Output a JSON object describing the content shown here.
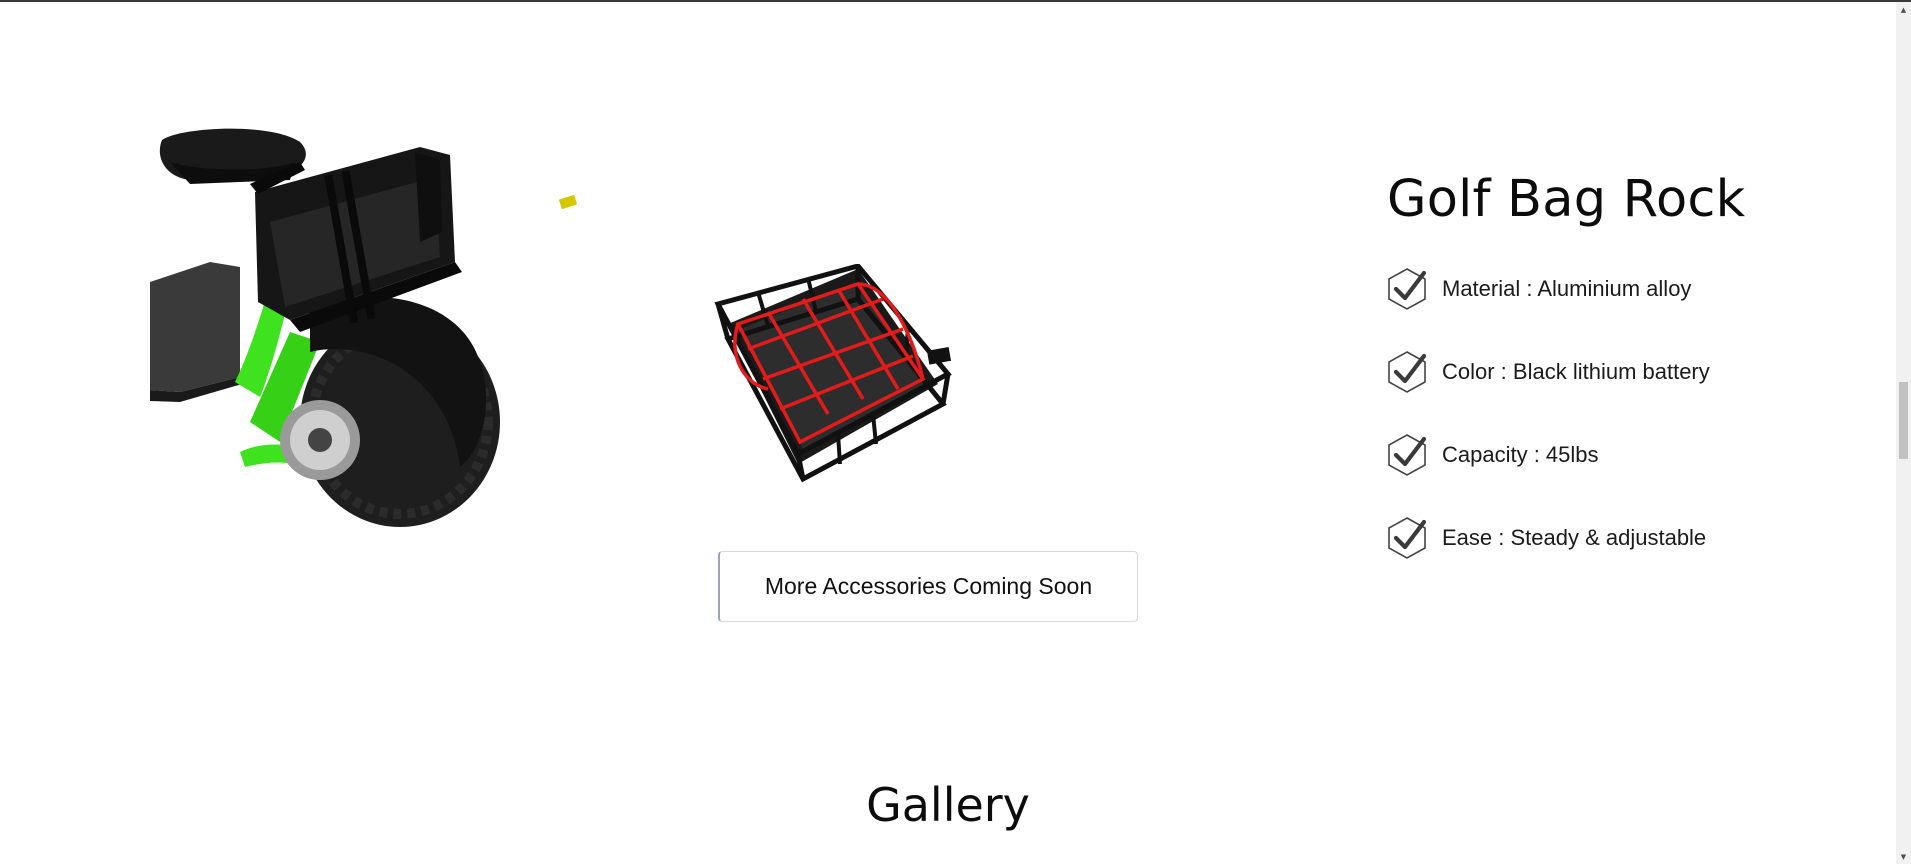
{
  "product": {
    "title": "Golf Bag Rock",
    "features": [
      {
        "text": "Material : Aluminium alloy",
        "icon": "checkmark-hexagon-icon"
      },
      {
        "text": "Color : Black lithium battery",
        "icon": "checkmark-hexagon-icon"
      },
      {
        "text": "Capacity : 45lbs",
        "icon": "checkmark-hexagon-icon"
      },
      {
        "text": "Ease : Steady & adjustable",
        "icon": "checkmark-hexagon-icon"
      }
    ]
  },
  "accessories": {
    "button_label": "More Accessories Coming Soon"
  },
  "gallery": {
    "title": "Gallery"
  },
  "colors": {
    "frame_green": "#3ee21e",
    "basket_net_red": "#e41b1b",
    "rack_black": "#111111"
  }
}
